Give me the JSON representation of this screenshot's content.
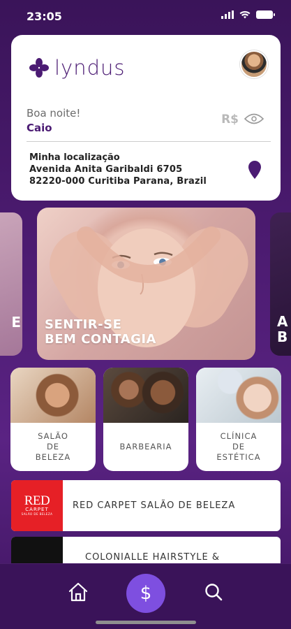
{
  "status_bar": {
    "time": "23:05"
  },
  "header": {
    "logo_text": "lyndus",
    "greeting": "Boa noite!",
    "user_name": "Caio",
    "balance_currency": "R$"
  },
  "location": {
    "title": "Minha localização",
    "line1": "Avenida Anita Garibaldi 6705",
    "line2": "82220-000 Curitiba Parana, Brazil"
  },
  "banners": {
    "left_fragment": "E",
    "main_line1": "SENTIR-SE",
    "main_line2": "BEM CONTAGIA",
    "right_line1": "A",
    "right_line2": "B"
  },
  "categories": [
    {
      "line1": "SALÃO",
      "line2": "DE",
      "line3": "BELEZA"
    },
    {
      "line1": "BARBEARIA"
    },
    {
      "line1": "CLÍNICA",
      "line2": "DE",
      "line3": "ESTÉTICA"
    }
  ],
  "salons": [
    {
      "logo_main": "RED",
      "logo_sub": "CARPET",
      "logo_tag": "SALÃO DE BELEZA",
      "name": "RED CARPET SALÃO DE BELEZA"
    },
    {
      "name": "COLONIALLE HAIRSTYLE &"
    }
  ],
  "bottom_nav": {
    "pay_symbol": "$"
  },
  "colors": {
    "brand_purple": "#4b1b73",
    "accent_violet": "#7e4fe0",
    "red_carpet": "#e62026"
  },
  "icons": [
    "signal-icon",
    "wifi-icon",
    "battery-icon",
    "lyndus-logo-icon",
    "eye-icon",
    "location-pin-icon",
    "home-icon",
    "dollar-icon",
    "search-icon"
  ]
}
